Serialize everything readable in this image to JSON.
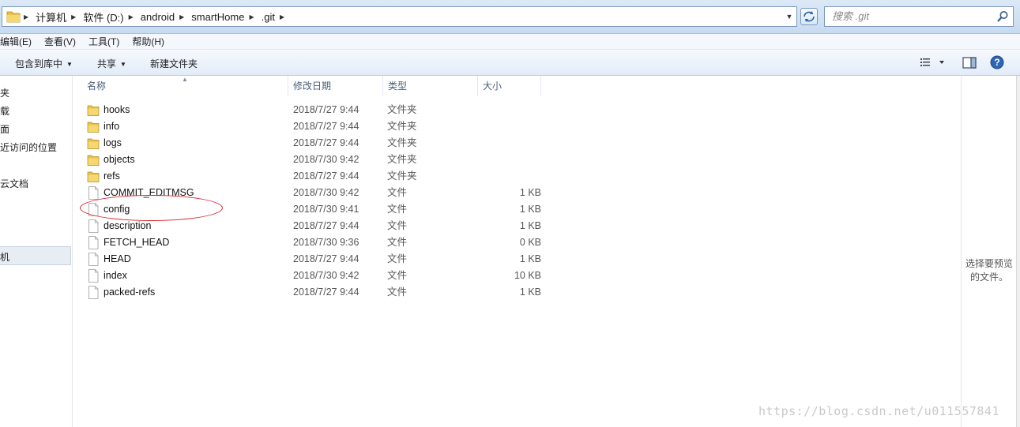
{
  "address_bar": {
    "breadcrumbs": [
      "计算机",
      "软件 (D:)",
      "android",
      "smartHome",
      ".git"
    ],
    "search_placeholder": "搜索 .git"
  },
  "menubar": {
    "items": [
      "编辑(E)",
      "查看(V)",
      "工具(T)",
      "帮助(H)"
    ]
  },
  "commandbar": {
    "include_library": "包含到库中",
    "share": "共享",
    "new_folder": "新建文件夹"
  },
  "navpane": {
    "items": [
      "夹",
      "载",
      "面",
      "近访问的位置",
      "云文档",
      "机"
    ]
  },
  "columns": {
    "name": "名称",
    "modified": "修改日期",
    "type": "类型",
    "size": "大小"
  },
  "files": [
    {
      "name": "hooks",
      "modified": "2018/7/27 9:44",
      "type": "文件夹",
      "size": "",
      "kind": "folder"
    },
    {
      "name": "info",
      "modified": "2018/7/27 9:44",
      "type": "文件夹",
      "size": "",
      "kind": "folder"
    },
    {
      "name": "logs",
      "modified": "2018/7/27 9:44",
      "type": "文件夹",
      "size": "",
      "kind": "folder"
    },
    {
      "name": "objects",
      "modified": "2018/7/30 9:42",
      "type": "文件夹",
      "size": "",
      "kind": "folder"
    },
    {
      "name": "refs",
      "modified": "2018/7/27 9:44",
      "type": "文件夹",
      "size": "",
      "kind": "folder"
    },
    {
      "name": "COMMIT_EDITMSG",
      "modified": "2018/7/30 9:42",
      "type": "文件",
      "size": "1 KB",
      "kind": "file"
    },
    {
      "name": "config",
      "modified": "2018/7/30 9:41",
      "type": "文件",
      "size": "1 KB",
      "kind": "file"
    },
    {
      "name": "description",
      "modified": "2018/7/27 9:44",
      "type": "文件",
      "size": "1 KB",
      "kind": "file"
    },
    {
      "name": "FETCH_HEAD",
      "modified": "2018/7/30 9:36",
      "type": "文件",
      "size": "0 KB",
      "kind": "file"
    },
    {
      "name": "HEAD",
      "modified": "2018/7/27 9:44",
      "type": "文件",
      "size": "1 KB",
      "kind": "file"
    },
    {
      "name": "index",
      "modified": "2018/7/30 9:42",
      "type": "文件",
      "size": "10 KB",
      "kind": "file"
    },
    {
      "name": "packed-refs",
      "modified": "2018/7/27 9:44",
      "type": "文件",
      "size": "1 KB",
      "kind": "file"
    }
  ],
  "preview": {
    "line1": "选择要预览",
    "line2": "的文件。"
  },
  "watermark": "https://blog.csdn.net/u011557841",
  "colors": {
    "highlight_circle": "#d6262c",
    "folder_yellow": "#e8c04a"
  }
}
